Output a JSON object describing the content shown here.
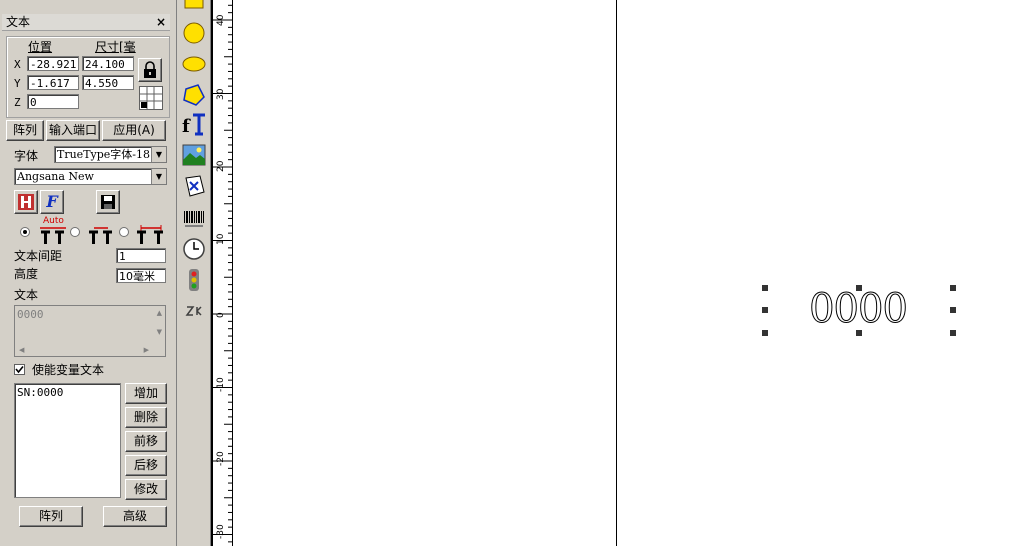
{
  "panel": {
    "title": "文本",
    "close": "×",
    "position_label": "位置",
    "size_label": "尺寸[毫",
    "x_label": "X",
    "y_label": "Y",
    "z_label": "Z",
    "x_pos": "-28.921",
    "y_pos": "-1.617",
    "z_pos": "0",
    "width": "24.100",
    "height": "4.550",
    "array_button": "阵列",
    "input_port_button": "输入端口",
    "apply_button": "应用(A)",
    "font_label": "字体",
    "font_type": "TrueType字体-18",
    "font_name": "Angsana New",
    "auto_label": "Auto",
    "spacing_label": "文本间距",
    "spacing_value": "1",
    "height_label": "高度",
    "height_value": "10毫米",
    "text_label": "文本",
    "text_value": "0000",
    "enable_var_label": "使能变量文本",
    "var_item": "SN:0000",
    "add_button": "增加",
    "delete_button": "删除",
    "forward_button": "前移",
    "backward_button": "后移",
    "modify_button": "修改",
    "bottom_array_button": "阵列",
    "advanced_button": "高级"
  },
  "ruler": {
    "ticks": [
      "40",
      "30",
      "20",
      "10",
      "0",
      "-10",
      "-20",
      "-30"
    ]
  },
  "canvas": {
    "text_object": "0000"
  },
  "colors": {
    "panel_bg": "#d4d0c8",
    "shape_fill": "#ffe000",
    "shape_stroke": "#7a5a00",
    "auto_red": "#d00000"
  }
}
